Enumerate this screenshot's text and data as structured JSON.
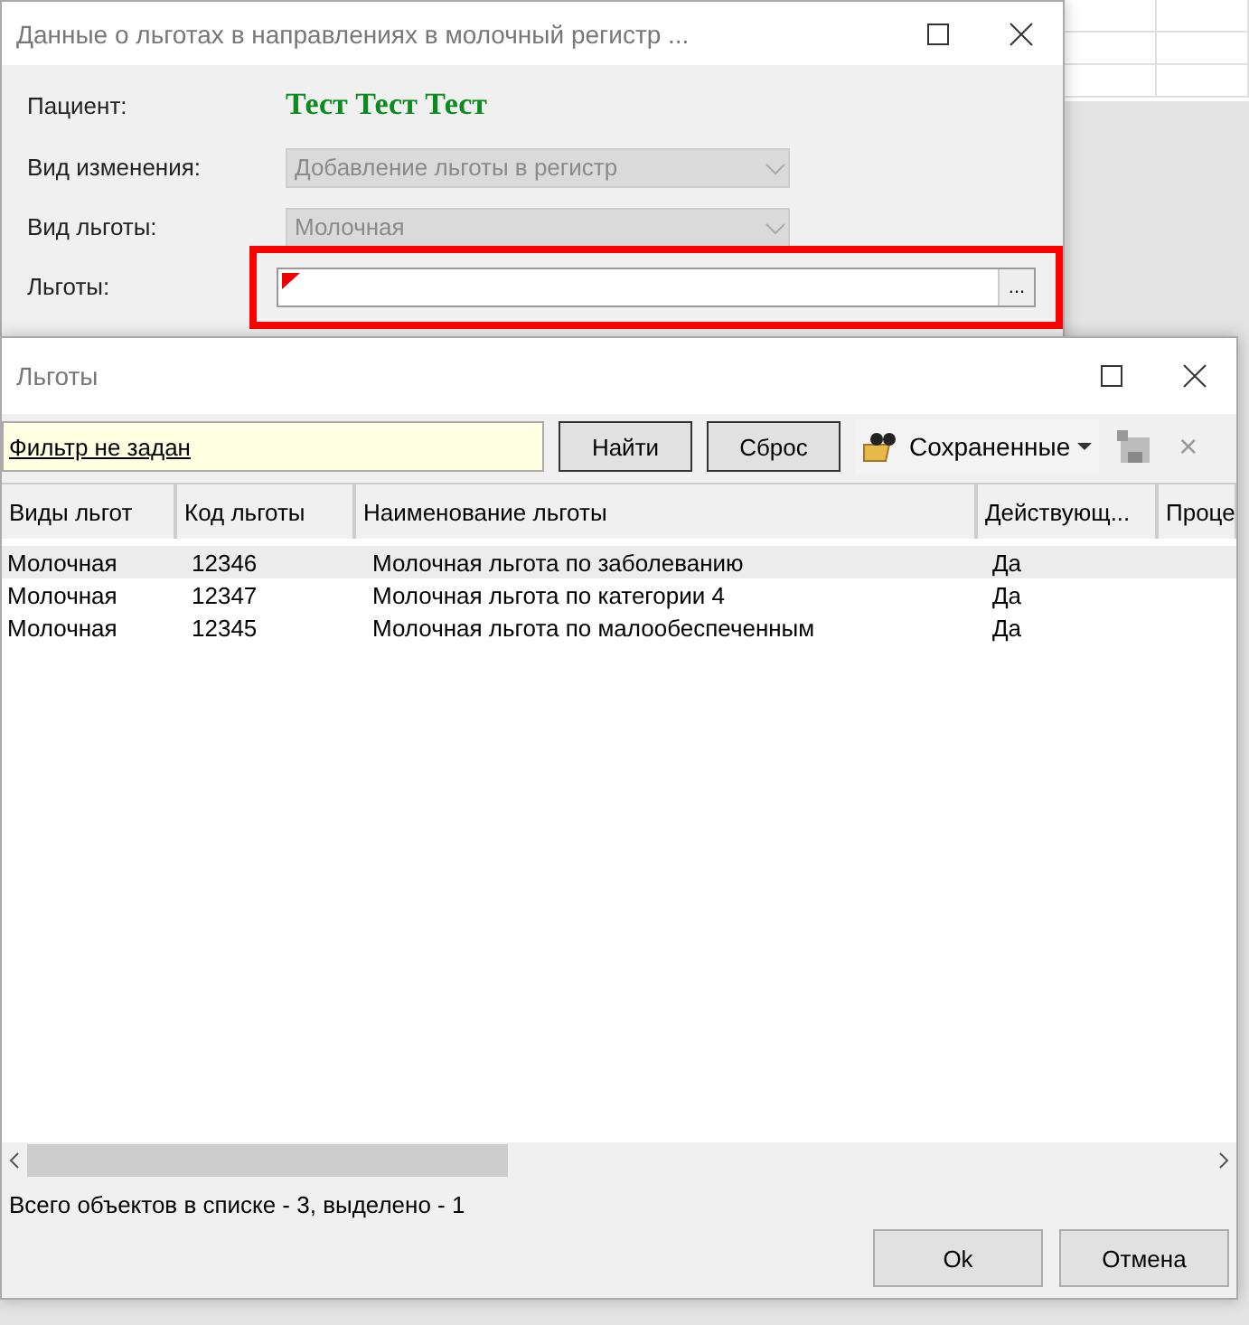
{
  "back_window": {
    "title": "Данные о льготах в направлениях в молочный регистр ...",
    "fields": [
      {
        "kind": "value",
        "label": "Пациент:",
        "value": "Тест Тест Тест"
      },
      {
        "kind": "combo",
        "label": "Вид изменения:",
        "value": "Добавление льготы в регистр",
        "disabled": true
      },
      {
        "kind": "combo",
        "label": "Вид льготы:",
        "value": "Молочная",
        "disabled": true
      },
      {
        "kind": "picker",
        "label": "Льготы:",
        "required": true,
        "highlighted": true,
        "button": "..."
      }
    ]
  },
  "dialog": {
    "title": "Льготы",
    "filter": {
      "link": "Фильтр не задан"
    },
    "buttons": [
      "Найти",
      "Сброс"
    ],
    "saved_menu": "Сохраненные",
    "clear_button": "×",
    "table": {
      "columns": [
        "Виды льгот",
        "Код льготы",
        "Наименование льготы",
        "Действующ...",
        "Проце"
      ],
      "rows": [
        {
          "cells": [
            "Молочная",
            "12346",
            "Молочная льгота по заболеванию",
            "Да"
          ],
          "selected": true
        },
        {
          "cells": [
            "Молочная",
            "12347",
            "Молочная льгота по категории 4",
            "Да"
          ],
          "selected": false
        },
        {
          "cells": [
            "Молочная",
            "12345",
            "Молочная льгота по малообеспеченным",
            "Да"
          ],
          "selected": false
        }
      ]
    },
    "status": "Всего объектов в списке - 3, выделено - 1",
    "actions": [
      "Ok",
      "Отмена"
    ]
  }
}
